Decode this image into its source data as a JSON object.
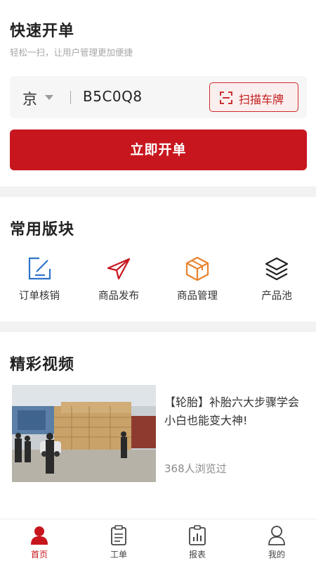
{
  "quick_order": {
    "title": "快速开单",
    "subtitle": "轻松一扫，让用户管理更加便捷",
    "province": "京",
    "plate_number": "B5C0Q8",
    "scan_label": "扫描车牌",
    "submit_label": "立即开单"
  },
  "common_blocks": {
    "title": "常用版块",
    "items": [
      {
        "label": "订单核销",
        "icon": "edit-icon"
      },
      {
        "label": "商品发布",
        "icon": "send-icon"
      },
      {
        "label": "商品管理",
        "icon": "box-icon"
      },
      {
        "label": "产品池",
        "icon": "layers-icon"
      }
    ]
  },
  "videos": {
    "title": "精彩视频",
    "items": [
      {
        "title": "【轮胎】补胎六大步骤学会小白也能变大神!",
        "views": "368人浏览过"
      }
    ]
  },
  "tabbar": {
    "active": "首页",
    "items": [
      {
        "label": "首页",
        "icon": "home-user-icon"
      },
      {
        "label": "工单",
        "icon": "clipboard-icon"
      },
      {
        "label": "报表",
        "icon": "report-icon"
      },
      {
        "label": "我的",
        "icon": "profile-icon"
      }
    ]
  },
  "colors": {
    "brand_red": "#c8161e",
    "icon_blue": "#2e74c9",
    "icon_orange": "#e8832e"
  }
}
